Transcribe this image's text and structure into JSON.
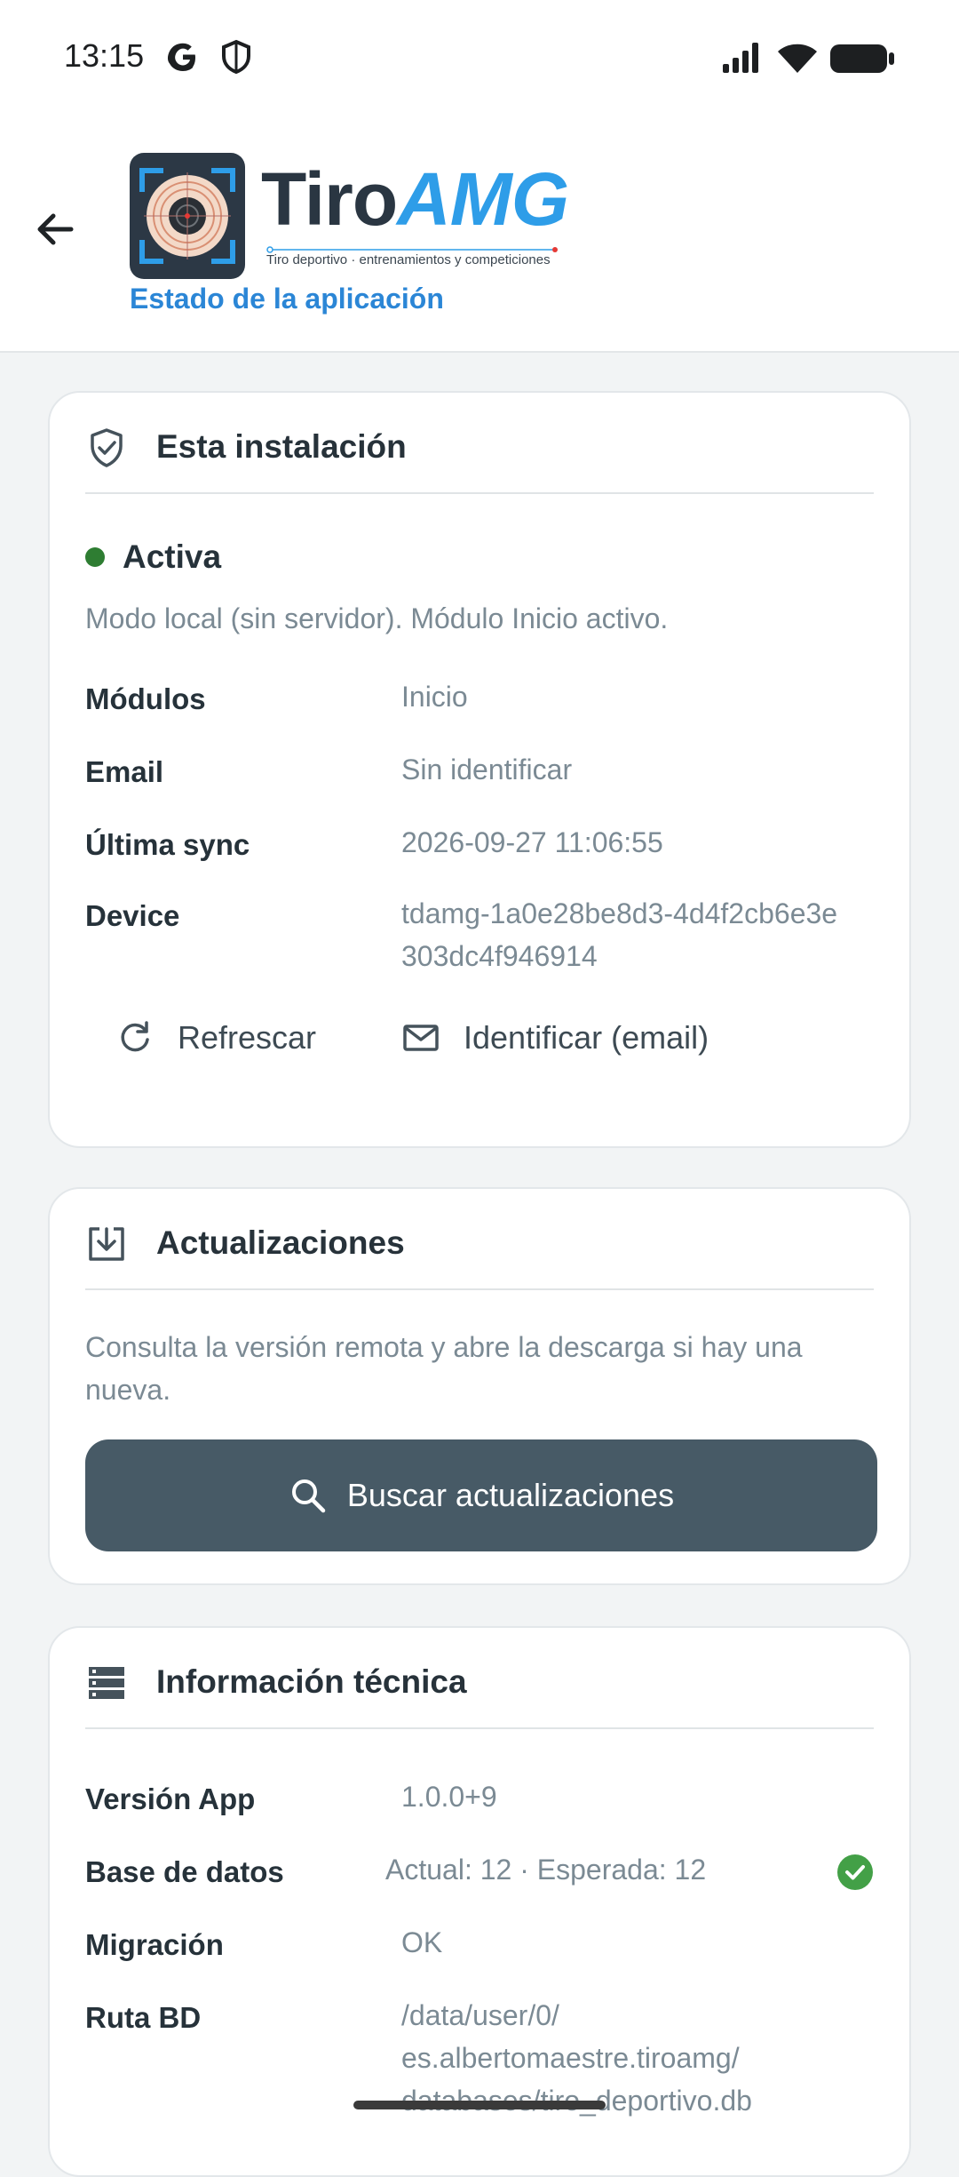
{
  "status_bar": {
    "time": "13:15",
    "icons": [
      "google-icon",
      "shield-icon",
      "signal-icon",
      "wifi-icon",
      "battery-icon"
    ]
  },
  "header": {
    "logo_tiro": "Tiro",
    "logo_amg": "AMG",
    "logo_tagline": "Tiro deportivo · entrenamientos y competiciones",
    "subtitle": "Estado de la aplicación"
  },
  "installation": {
    "title": "Esta instalación",
    "status": "Activa",
    "status_color": "#2e7d32",
    "description": "Modo local (sin servidor). Módulo Inicio activo.",
    "rows": [
      {
        "label": "Módulos",
        "value": "Inicio"
      },
      {
        "label": "Email",
        "value": "Sin identificar"
      },
      {
        "label": "Última sync",
        "value": "2026-09-27 11:06:55"
      },
      {
        "label": "Device",
        "value_line1": "tdamg-1a0e28be8d3-4d4f2cb6e3e",
        "value_line2": "303dc4f946914"
      }
    ],
    "refresh_label": "Refrescar",
    "identify_label": "Identificar (email)"
  },
  "updates": {
    "title": "Actualizaciones",
    "description_line1": "Consulta la versión remota y abre la descarga si hay una",
    "description_line2": "nueva.",
    "button_label": "Buscar actualizaciones"
  },
  "technical": {
    "title": "Información técnica",
    "rows": [
      {
        "label": "Versión App",
        "value": "1.0.0+9"
      },
      {
        "label": "Base de datos",
        "value": "Actual: 12 · Esperada: 12"
      },
      {
        "label": "Migración",
        "value": "OK"
      },
      {
        "label": "Ruta BD",
        "value_line1": "/data/user/0/",
        "value_line2": "es.albertomaestre.tiroamg/",
        "value_line3": "databases/tiro_deportivo.db"
      }
    ]
  },
  "colors": {
    "accent": "#2b86d6",
    "primary_button": "#475a66",
    "success": "#43a047"
  }
}
